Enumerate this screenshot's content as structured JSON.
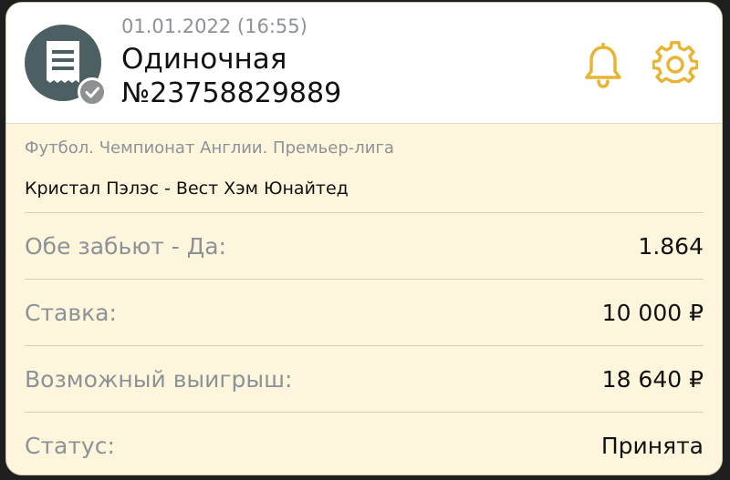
{
  "ticket": {
    "date": "01.01.2022 (16:55)",
    "type": "Одиночная",
    "number": "№23758829889",
    "icons": {
      "receipt": "receipt-icon",
      "status": "checkmark-icon",
      "notifications": "bell-icon",
      "settings": "gear-icon"
    }
  },
  "event": {
    "league": "Футбол. Чемпионат Англии. Премьер-лига",
    "match": "Кристал Пэлэс - Вест Хэм Юнайтед"
  },
  "rows": [
    {
      "label": "Обе забьют - Да:",
      "value": "1.864"
    },
    {
      "label": "Ставка:",
      "value": "10 000 ₽"
    },
    {
      "label": "Возможный выигрыш:",
      "value": "18 640 ₽"
    },
    {
      "label": "Статус:",
      "value": "Принята"
    }
  ],
  "colors": {
    "accent": "#e8b434",
    "card_background": "#fdf6dc",
    "header_background": "#ffffff",
    "icon_circle": "#4c5f63",
    "muted_text": "#8c9297"
  }
}
